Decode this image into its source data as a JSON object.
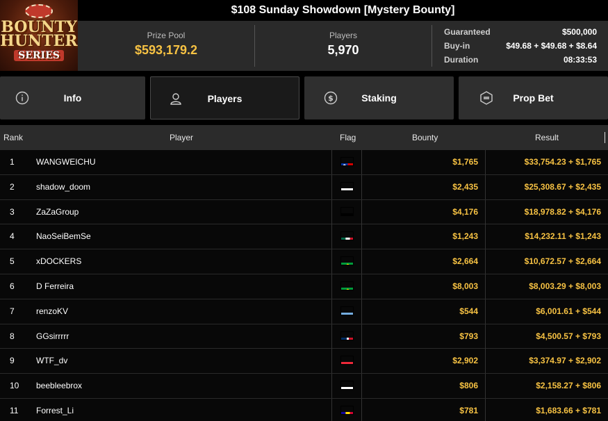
{
  "logo": {
    "line1": "BOUNTY",
    "line2": "HUNTERS",
    "line3": "SERIES"
  },
  "tournament": {
    "title": "$108 Sunday Showdown [Mystery Bounty]"
  },
  "stats": {
    "prize_pool_label": "Prize Pool",
    "prize_pool_value": "$593,179.2",
    "players_label": "Players",
    "players_value": "5,970",
    "guaranteed_label": "Guaranteed",
    "guaranteed_value": "$500,000",
    "buyin_label": "Buy-in",
    "buyin_value": "$49.68 + $49.68 + $8.64",
    "duration_label": "Duration",
    "duration_value": "08:33:53"
  },
  "tabs": [
    {
      "label": "Info",
      "icon": "info-icon"
    },
    {
      "label": "Players",
      "icon": "user-icon",
      "active": true
    },
    {
      "label": "Staking",
      "icon": "staking-icon"
    },
    {
      "label": "Prop Bet",
      "icon": "prop-bet-icon"
    }
  ],
  "columns": {
    "rank": "Rank",
    "player": "Player",
    "flag": "Flag",
    "bounty": "Bounty",
    "result": "Result"
  },
  "rows": [
    {
      "rank": "1",
      "player": "WANGWEICHU",
      "flag": "taiwan",
      "bounty": "$1,765",
      "result": "$33,754.23 + $1,765"
    },
    {
      "rank": "2",
      "player": "shadow_doom",
      "flag": "russia",
      "bounty": "$2,435",
      "result": "$25,308.67 + $2,435"
    },
    {
      "rank": "3",
      "player": "ZaZaGroup",
      "flag": "germany",
      "bounty": "$4,176",
      "result": "$18,978.82 + $4,176"
    },
    {
      "rank": "4",
      "player": "NaoSeiBemSe",
      "flag": "mexico",
      "bounty": "$1,243",
      "result": "$14,232.11 + $1,243"
    },
    {
      "rank": "5",
      "player": "xDOCKERS",
      "flag": "brazil",
      "bounty": "$2,664",
      "result": "$10,672.57 + $2,664"
    },
    {
      "rank": "6",
      "player": "D Ferreira",
      "flag": "brazil",
      "bounty": "$8,003",
      "result": "$8,003.29 + $8,003"
    },
    {
      "rank": "7",
      "player": "renzoKV",
      "flag": "argentina",
      "bounty": "$544",
      "result": "$6,001.61 + $544"
    },
    {
      "rank": "8",
      "player": "GGsirrrrr",
      "flag": "dominican-republic",
      "bounty": "$793",
      "result": "$4,500.57 + $793"
    },
    {
      "rank": "9",
      "player": "WTF_dv",
      "flag": "austria",
      "bounty": "$2,902",
      "result": "$3,374.97 + $2,902"
    },
    {
      "rank": "10",
      "player": "beebleebrox",
      "flag": "cyprus",
      "bounty": "$806",
      "result": "$2,158.27 + $806"
    },
    {
      "rank": "11",
      "player": "Forrest_Li",
      "flag": "andorra",
      "bounty": "$781",
      "result": "$1,683.66 + $781"
    }
  ],
  "colors": {
    "accent": "#f7c243",
    "background": "#000000",
    "panel": "#2a2a2a",
    "tab": "#2f2f2f"
  }
}
